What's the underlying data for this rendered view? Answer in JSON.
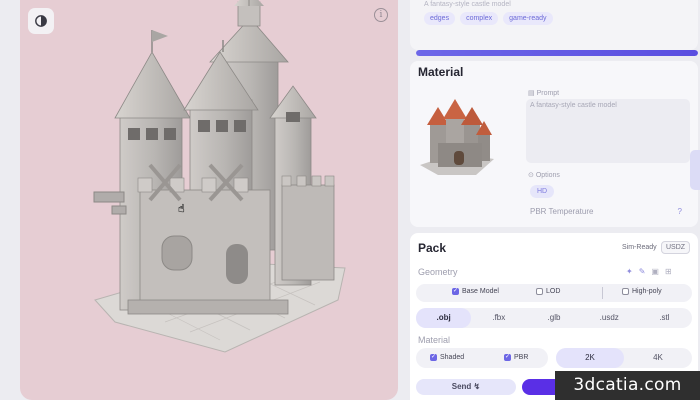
{
  "viewport": {
    "background_color": "#e6cdd3",
    "mode_icon": "half-circle-icon",
    "info_icon_glyph": "i"
  },
  "generation": {
    "description": "A fantasy-style castle model",
    "tags": [
      "edges",
      "complex",
      "game-ready"
    ],
    "progress_fraction": 1.0
  },
  "material": {
    "title": "Material",
    "prompt_label": "Prompt",
    "prompt_text": "A fantasy-style castle model",
    "options_label": "Options",
    "option_chip": "HD",
    "pbr_label": "PBR Temperature",
    "pbr_value": "?"
  },
  "pack": {
    "title": "Pack",
    "sim_ready_label": "Sim-Ready",
    "sim_ready_format": "USDZ",
    "geometry_label": "Geometry",
    "geometry_options": [
      {
        "label": "Base Model",
        "checked": true
      },
      {
        "label": "LOD",
        "checked": false
      },
      {
        "label": "High-poly",
        "checked": false
      }
    ],
    "formats": [
      ".obj",
      ".fbx",
      ".glb",
      ".usdz",
      ".stl"
    ],
    "active_format": ".obj",
    "material_label": "Material",
    "material_options": [
      {
        "label": "Shaded",
        "checked": true
      },
      {
        "label": "PBR",
        "checked": true
      }
    ],
    "resolutions": [
      "2K",
      "4K"
    ],
    "active_resolution": "2K",
    "send_label": "Send",
    "accent_color": "#5a2fe6"
  },
  "watermark": "3dcatia.com"
}
